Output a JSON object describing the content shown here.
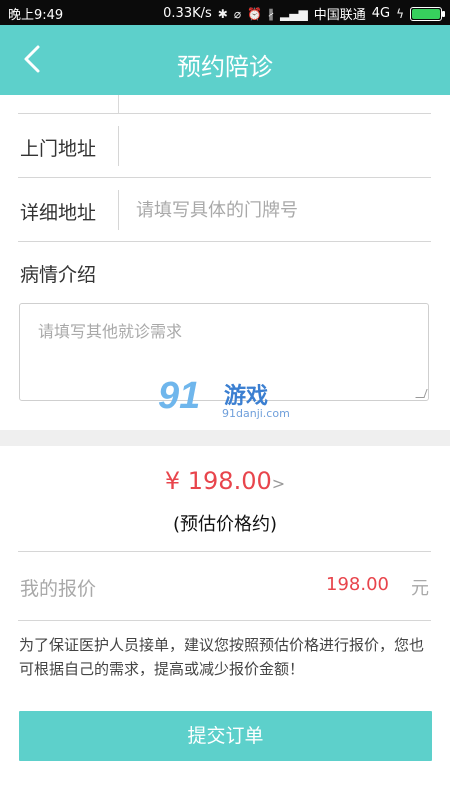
{
  "status_bar": {
    "time": "晚上9:49",
    "network_speed": "0.33K/s",
    "carrier": "中国联通",
    "network_type": "4G",
    "icons": [
      "bluetooth-icon",
      "no-disturb-icon",
      "alarm-icon",
      "vibrate-icon",
      "signal-icon",
      "charging-icon",
      "battery-icon"
    ]
  },
  "nav": {
    "title": "预约陪诊",
    "back_icon": "chevron-left-icon",
    "background": "#5dd0cb"
  },
  "form": {
    "visit_address": {
      "label": "上门地址",
      "value": ""
    },
    "detail_address": {
      "label": "详细地址",
      "placeholder": "请填写具体的门牌号"
    },
    "condition": {
      "label": "病情介绍",
      "placeholder": "请填写其他就诊需求"
    }
  },
  "watermark": {
    "logo_text": "91",
    "name": "游戏",
    "url": "91danji.com"
  },
  "pricing": {
    "estimated_price": "¥ 198.00",
    "arrow": ">",
    "note": "(预估价格约)",
    "offer_label": "我的报价",
    "offer_value": "198.00",
    "offer_unit": "元",
    "price_color": "#e8454c"
  },
  "tip": "为了保证医护人员接单，建议您按照预估价格进行报价，您也可根据自己的需求，提高或减少报价金额！",
  "submit": {
    "label": "提交订单"
  }
}
